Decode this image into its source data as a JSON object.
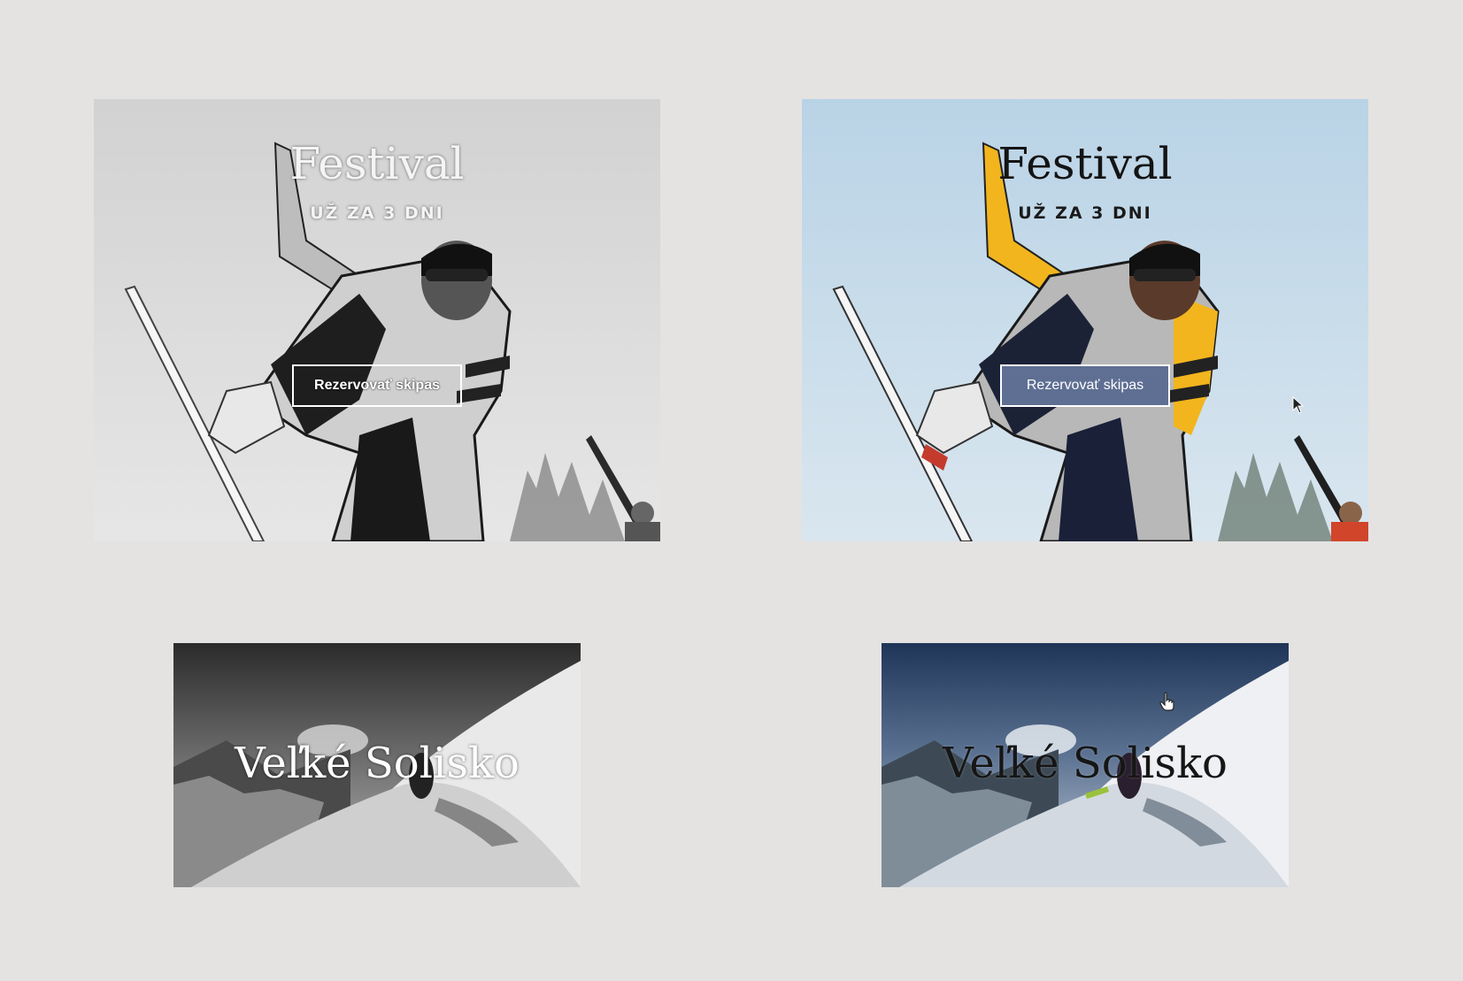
{
  "festival_cards": [
    {
      "variant": "grayscale",
      "title": "Festival",
      "subtitle": "UŽ ZA 3 DNI",
      "button_label": "Rezervovať skipas"
    },
    {
      "variant": "color-hover",
      "title": "Festival",
      "subtitle": "UŽ ZA 3 DNI",
      "button_label": "Rezervovať skipas"
    }
  ],
  "solisko_cards": [
    {
      "variant": "grayscale",
      "title": "Veľké Solisko"
    },
    {
      "variant": "color-hover",
      "title": "Veľké Solisko"
    }
  ],
  "colors": {
    "page_background": "#e4e3e2",
    "button_hover_background": "#5f6f93",
    "jacket_yellow": "#f2b51e"
  },
  "icons": {
    "arrow_cursor": "arrow-cursor-icon",
    "hand_cursor": "hand-pointer-cursor-icon"
  }
}
